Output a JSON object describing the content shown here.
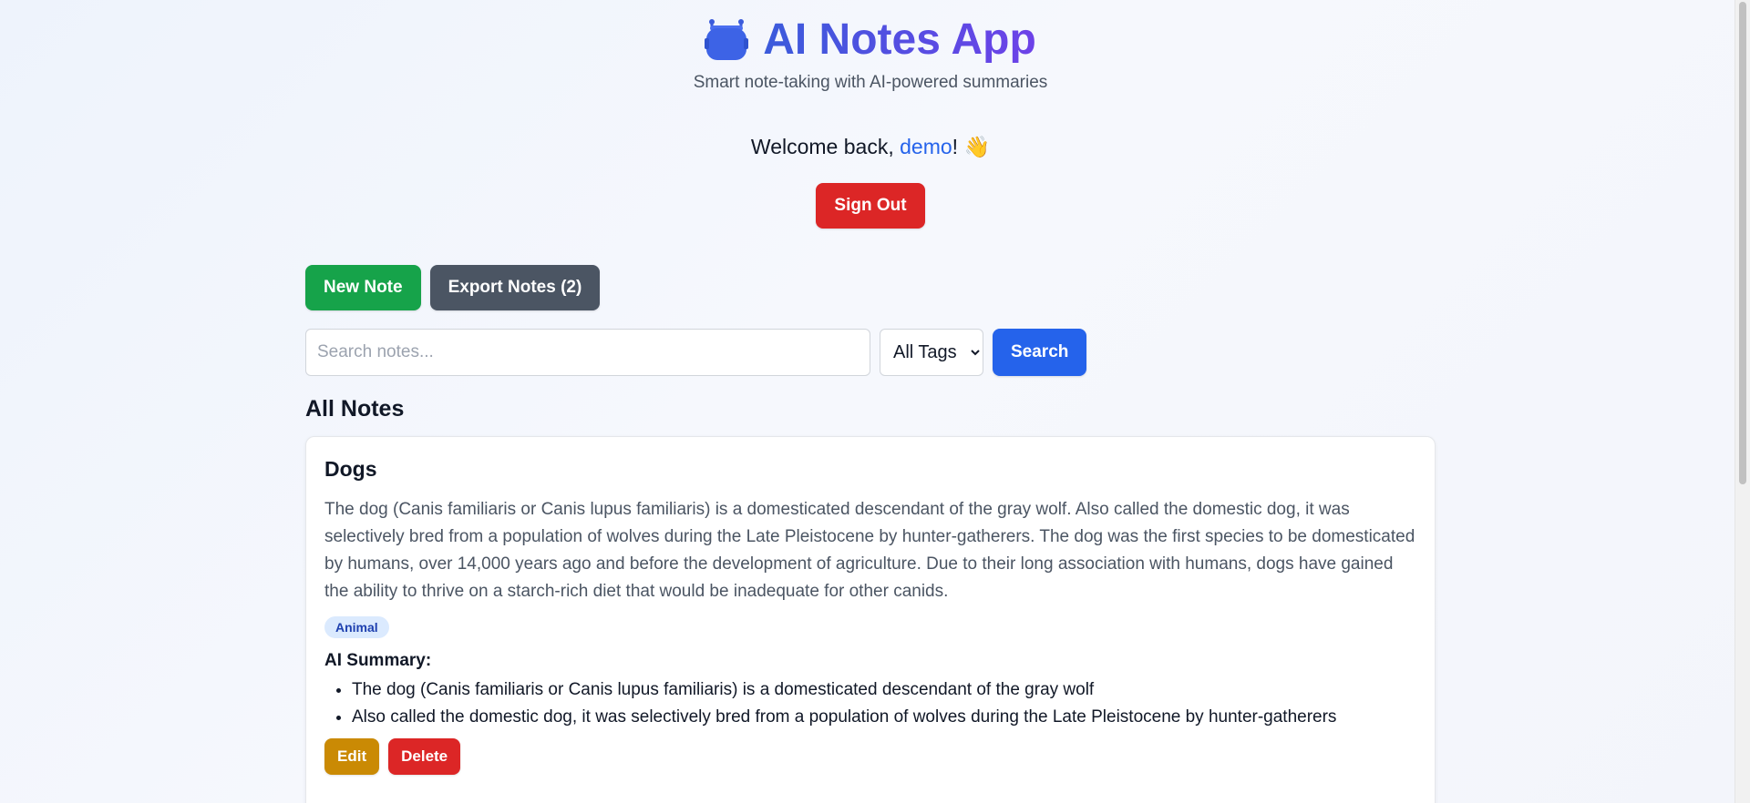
{
  "header": {
    "icon": "robot-icon",
    "title": "AI Notes App",
    "subtitle": "Smart note-taking with AI-powered summaries",
    "title_gradient": [
      "#3b5bdb",
      "#6d42e8"
    ]
  },
  "welcome": {
    "prefix": "Welcome back, ",
    "username": "demo",
    "suffix": "! ",
    "emoji": "👋"
  },
  "auth": {
    "sign_out_label": "Sign Out"
  },
  "toolbar": {
    "new_note_label": "New Note",
    "export_label": "Export Notes (2)"
  },
  "search": {
    "placeholder": "Search notes...",
    "value": "",
    "tag_filter": {
      "selected": "All Tags"
    },
    "button_label": "Search"
  },
  "notes_section": {
    "title": "All Notes"
  },
  "notes": [
    {
      "title": "Dogs",
      "body": "The dog (Canis familiaris or Canis lupus familiaris) is a domesticated descendant of the gray wolf. Also called the domestic dog, it was selectively bred from a population of wolves during the Late Pleistocene by hunter-gatherers. The dog was the first species to be domesticated by humans, over 14,000 years ago and before the development of agriculture. Due to their long association with humans, dogs have gained the ability to thrive on a starch-rich diet that would be inadequate for other canids.",
      "tag": "Animal",
      "summary_heading": "AI Summary:",
      "summary": [
        "The dog (Canis familiaris or Canis lupus familiaris) is a domesticated descendant of the gray wolf",
        "Also called the domestic dog, it was selectively bred from a population of wolves during the Late Pleistocene by hunter-gatherers"
      ],
      "edit_label": "Edit",
      "delete_label": "Delete"
    }
  ],
  "colors": {
    "primary": "#2563eb",
    "success": "#16a34a",
    "danger": "#dc2626",
    "warning": "#ca8a04",
    "neutral": "#4b5563"
  }
}
